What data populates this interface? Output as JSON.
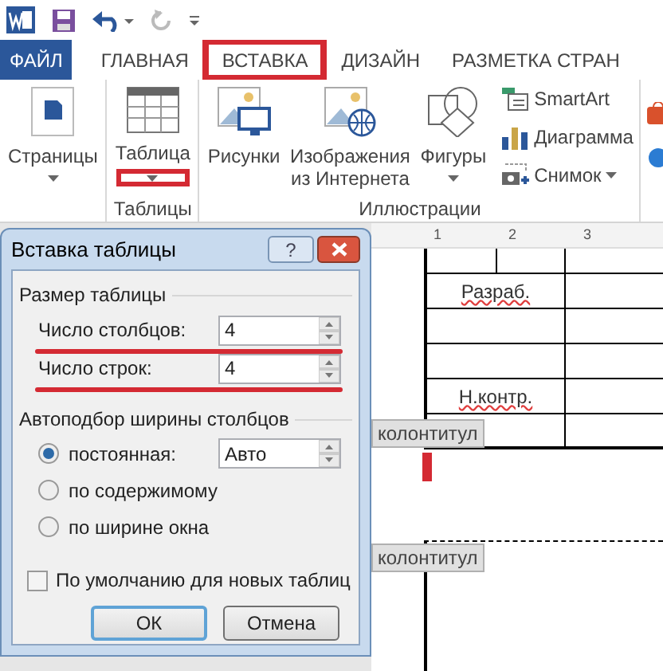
{
  "tabs": [
    {
      "label": "ФАЙЛ",
      "kind": "file",
      "selected": false,
      "highlighted": false
    },
    {
      "label": "ГЛАВНАЯ",
      "kind": "tab",
      "selected": false,
      "highlighted": false
    },
    {
      "label": "ВСТАВКА",
      "kind": "tab",
      "selected": true,
      "highlighted": true
    },
    {
      "label": "ДИЗАЙН",
      "kind": "tab",
      "selected": false,
      "highlighted": false
    },
    {
      "label": "РАЗМЕТКА СТРАН",
      "kind": "tab",
      "selected": false,
      "highlighted": false
    }
  ],
  "ribbon": {
    "groups": [
      {
        "buttons": [
          {
            "kind": "pages",
            "label": "Страницы",
            "dropdown": true
          }
        ]
      },
      {
        "label": "Таблицы",
        "buttons": [
          {
            "kind": "table",
            "label": "Таблица",
            "dropdown": true,
            "highlighted": true
          }
        ]
      },
      {
        "label": "Иллюстрации",
        "buttons": [
          {
            "kind": "pictures",
            "label": "Рисунки"
          },
          {
            "kind": "online",
            "label": "Изображения из Интернета"
          },
          {
            "kind": "shapes",
            "label": "Фигуры",
            "dropdown": true
          }
        ],
        "small_buttons": [
          {
            "kind": "smartart",
            "label": "SmartArt"
          },
          {
            "kind": "chart",
            "label": "Диаграмма"
          },
          {
            "kind": "screenshot",
            "label": "Снимок",
            "dropdown": true
          }
        ]
      }
    ]
  },
  "dialog": {
    "title": "Вставка таблицы",
    "help_button": "?",
    "size_group": {
      "title": "Размер таблицы",
      "fields": [
        {
          "label": "Число столбцов:",
          "value": "4",
          "highlighted": true
        },
        {
          "label": "Число строк:",
          "value": "4",
          "highlighted": true
        }
      ]
    },
    "autofit_group": {
      "title": "Автоподбор ширины столбцов",
      "options": [
        {
          "label": "постоянная:",
          "selected": true,
          "value": "Авто"
        },
        {
          "label": "по содержимому",
          "selected": false
        },
        {
          "label": "по ширине окна",
          "selected": false
        }
      ]
    },
    "default_checkbox": {
      "label": "По умолчанию для новых таблиц",
      "checked": false
    },
    "buttons": [
      {
        "label": "ОК",
        "default": true
      },
      {
        "label": "Отмена",
        "default": false
      }
    ]
  },
  "document": {
    "ruler_numbers": [
      "1",
      "2",
      "3"
    ],
    "rows": [
      {
        "kind": "text",
        "label": "Разраб.",
        "spelling_error": true
      },
      {
        "kind": "blank"
      },
      {
        "kind": "blank"
      },
      {
        "kind": "text",
        "label": "Н.контр.",
        "spelling_error": true
      },
      {
        "kind": "blank"
      }
    ],
    "footer_tab": "колонтитул",
    "header_tab": "колонтитул",
    "cursor_marked": true
  }
}
